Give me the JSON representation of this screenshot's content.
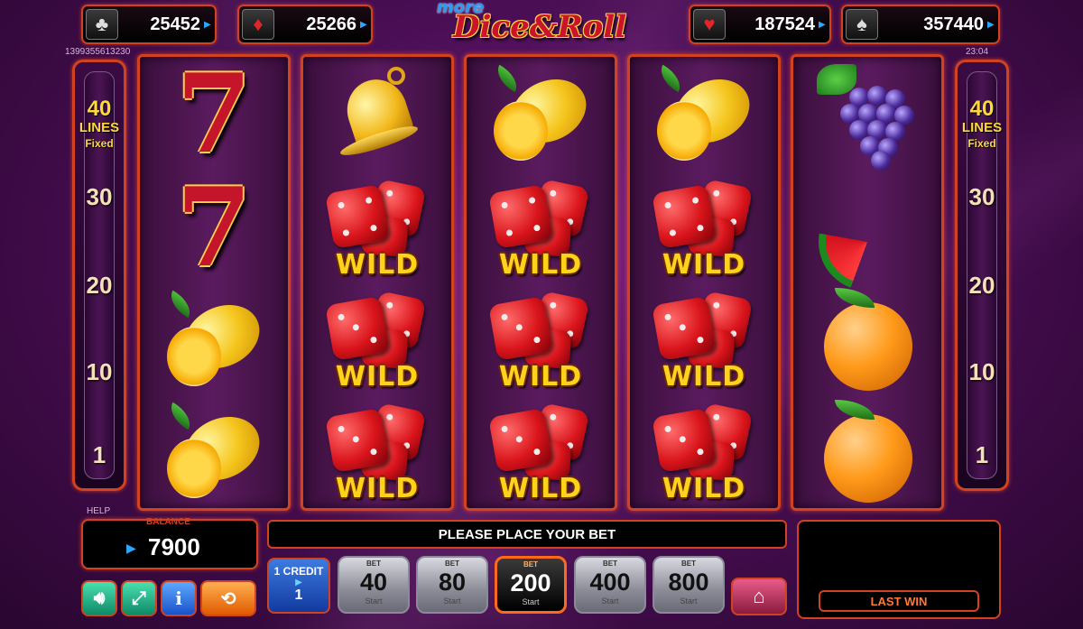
{
  "jackpots": [
    {
      "suit": "clubs",
      "symbol": "♣",
      "value": "25452"
    },
    {
      "suit": "diamonds",
      "symbol": "♦",
      "value": "25266"
    },
    {
      "suit": "hearts",
      "symbol": "♥",
      "value": "187524"
    },
    {
      "suit": "spades",
      "symbol": "♠",
      "value": "357440"
    }
  ],
  "logo": {
    "prefix": "more",
    "title": "Dice&Roll"
  },
  "session_id": "1399355613230",
  "clock": "23:04",
  "lines": {
    "count": "40",
    "label": "LINES",
    "mode": "Fixed",
    "markers": [
      "30",
      "20",
      "10",
      "1"
    ]
  },
  "reels": [
    [
      "seven",
      "seven",
      "lemon",
      "lemon"
    ],
    [
      "bell",
      "wild",
      "wild",
      "wild"
    ],
    [
      "lemon",
      "wild",
      "wild",
      "wild"
    ],
    [
      "lemon",
      "wild",
      "wild",
      "wild"
    ],
    [
      "grapes",
      "watermelon",
      "orange",
      "orange"
    ]
  ],
  "symbols": {
    "seven": "7",
    "wild": "WILD"
  },
  "help_label": "HELP",
  "balance": {
    "label": "BALANCE",
    "amount": "7900",
    "currency_icon": "euro-icon"
  },
  "message": "PLEASE PLACE YOUR BET",
  "credit": {
    "line1": "1 CREDIT",
    "value": "1"
  },
  "bets": [
    {
      "label": "BET",
      "value": "40",
      "start": "Start",
      "active": false
    },
    {
      "label": "BET",
      "value": "80",
      "start": "Start",
      "active": false
    },
    {
      "label": "BET",
      "value": "200",
      "start": "Start",
      "active": true
    },
    {
      "label": "BET",
      "value": "400",
      "start": "Start",
      "active": false
    },
    {
      "label": "BET",
      "value": "800",
      "start": "Start",
      "active": false
    }
  ],
  "last_win": {
    "label": "LAST WIN"
  },
  "controls": {
    "sound": "speaker-icon",
    "fullscreen": "fullscreen-icon",
    "info": "i",
    "autoplay": "autoplay-icon",
    "home": "home-icon"
  },
  "colors": {
    "frame": "#d2421e",
    "accent": "#ffd83a",
    "currency": "#2aa8ff"
  }
}
